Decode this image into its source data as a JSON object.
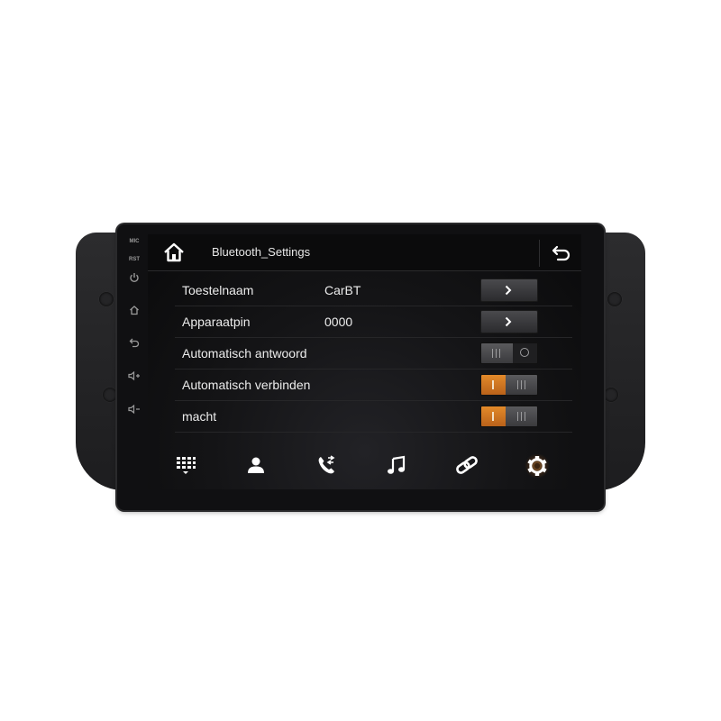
{
  "side_panel": {
    "mic_label": "MIC",
    "rst_label": "RST"
  },
  "header": {
    "title": "Bluetooth_Settings"
  },
  "settings": [
    {
      "label": "Toestelnaam",
      "value": "CarBT",
      "control": "arrow"
    },
    {
      "label": "Apparaatpin",
      "value": "0000",
      "control": "arrow"
    },
    {
      "label": "Automatisch antwoord",
      "value": "",
      "control": "toggle",
      "state": "off"
    },
    {
      "label": "Automatisch verbinden",
      "value": "",
      "control": "toggle",
      "state": "on"
    },
    {
      "label": "macht",
      "value": "",
      "control": "toggle",
      "state": "on"
    }
  ],
  "nav": [
    {
      "icon": "dialpad-icon",
      "active": false
    },
    {
      "icon": "contacts-icon",
      "active": false
    },
    {
      "icon": "call-log-icon",
      "active": false
    },
    {
      "icon": "music-icon",
      "active": false
    },
    {
      "icon": "link-icon",
      "active": false
    },
    {
      "icon": "settings-gear-icon",
      "active": true
    }
  ],
  "colors": {
    "accent": "#e38a2a",
    "screen_bg": "#141416",
    "text": "#ececec"
  }
}
